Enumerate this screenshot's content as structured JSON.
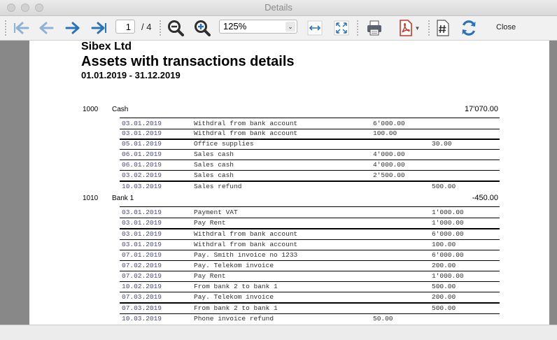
{
  "window": {
    "title": "Details"
  },
  "toolbar": {
    "current_page": "1",
    "total_pages": "/ 4",
    "zoom": "125%",
    "close_label": "Close"
  },
  "report": {
    "company": "Sibex Ltd",
    "title": "Assets with transactions details",
    "period": "01.01.2019 - 31.12.2019"
  },
  "accounts": [
    {
      "number": "1000",
      "name": "Cash",
      "balance": "17'070.00",
      "rows": [
        {
          "date": "03.01.2019",
          "desc": "Withdral from bank account",
          "debit": "6'000.00",
          "credit": ""
        },
        {
          "date": "03.01.2019",
          "desc": "Withdral from bank account",
          "debit": "100.00",
          "credit": ""
        },
        {
          "date": "05.01.2019",
          "desc": "Office supplies",
          "debit": "",
          "credit": "30.00"
        },
        {
          "date": "06.01.2019",
          "desc": "Sales cash",
          "debit": "4'000.00",
          "credit": ""
        },
        {
          "date": "06.01.2019",
          "desc": "Sales cash",
          "debit": "4'000.00",
          "credit": ""
        },
        {
          "date": "03.02.2019",
          "desc": "Sales cash",
          "debit": "2'500.00",
          "credit": ""
        },
        {
          "date": "10.03.2019",
          "desc": "Sales refund",
          "debit": "",
          "credit": "500.00"
        }
      ]
    },
    {
      "number": "1010",
      "name": "Bank 1",
      "balance": "-450.00",
      "rows": [
        {
          "date": "03.01.2019",
          "desc": "Payment VAT",
          "debit": "",
          "credit": "1'000.00"
        },
        {
          "date": "03.01.2019",
          "desc": "Pay Rent",
          "debit": "",
          "credit": "1'000.00"
        },
        {
          "date": "03.01.2019",
          "desc": "Withdral from bank account",
          "debit": "",
          "credit": "6'000.00"
        },
        {
          "date": "03.01.2019",
          "desc": "Withdral from bank account",
          "debit": "",
          "credit": "100.00"
        },
        {
          "date": "07.01.2019",
          "desc": "Pay. Smith invoice no 1233",
          "debit": "",
          "credit": "6'000.00"
        },
        {
          "date": "07.02.2019",
          "desc": "Pay. Telekom invoice",
          "debit": "",
          "credit": "200.00"
        },
        {
          "date": "07.02.2019",
          "desc": "Pay Rent",
          "debit": "",
          "credit": "1'000.00"
        },
        {
          "date": "10.02.2019",
          "desc": "From bank 2 to bank 1",
          "debit": "",
          "credit": "500.00"
        },
        {
          "date": "07.03.2019",
          "desc": "Pay. Telekom invoice",
          "debit": "",
          "credit": "200.00"
        },
        {
          "date": "07.03.2019",
          "desc": "From bank 2 to bank 1",
          "debit": "",
          "credit": "500.00"
        },
        {
          "date": "10.03.2019",
          "desc": "Phone invoice refund",
          "debit": "50.00",
          "credit": ""
        }
      ]
    }
  ]
}
